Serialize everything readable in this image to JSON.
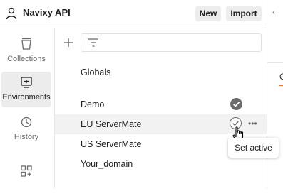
{
  "header": {
    "workspace_title": "Navixy API",
    "new_label": "New",
    "import_label": "Import"
  },
  "sidebar": {
    "items": [
      {
        "label": "Collections",
        "icon": "collections-icon",
        "active": false
      },
      {
        "label": "Environments",
        "icon": "environments-icon",
        "active": true
      },
      {
        "label": "History",
        "icon": "history-icon",
        "active": false
      },
      {
        "label": "",
        "icon": "configure-workbench-icon",
        "active": false
      }
    ]
  },
  "environments": {
    "globals_label": "Globals",
    "items": [
      {
        "name": "Demo",
        "active": true
      },
      {
        "name": "EU ServerMate",
        "active": false,
        "hovered": true
      },
      {
        "name": "US ServerMate",
        "active": false
      },
      {
        "name": "Your_domain",
        "active": false
      }
    ]
  },
  "tooltip": {
    "text": "Set active"
  },
  "right_pane": {
    "partial_text": "G",
    "accent_color": "#ff6c37"
  }
}
